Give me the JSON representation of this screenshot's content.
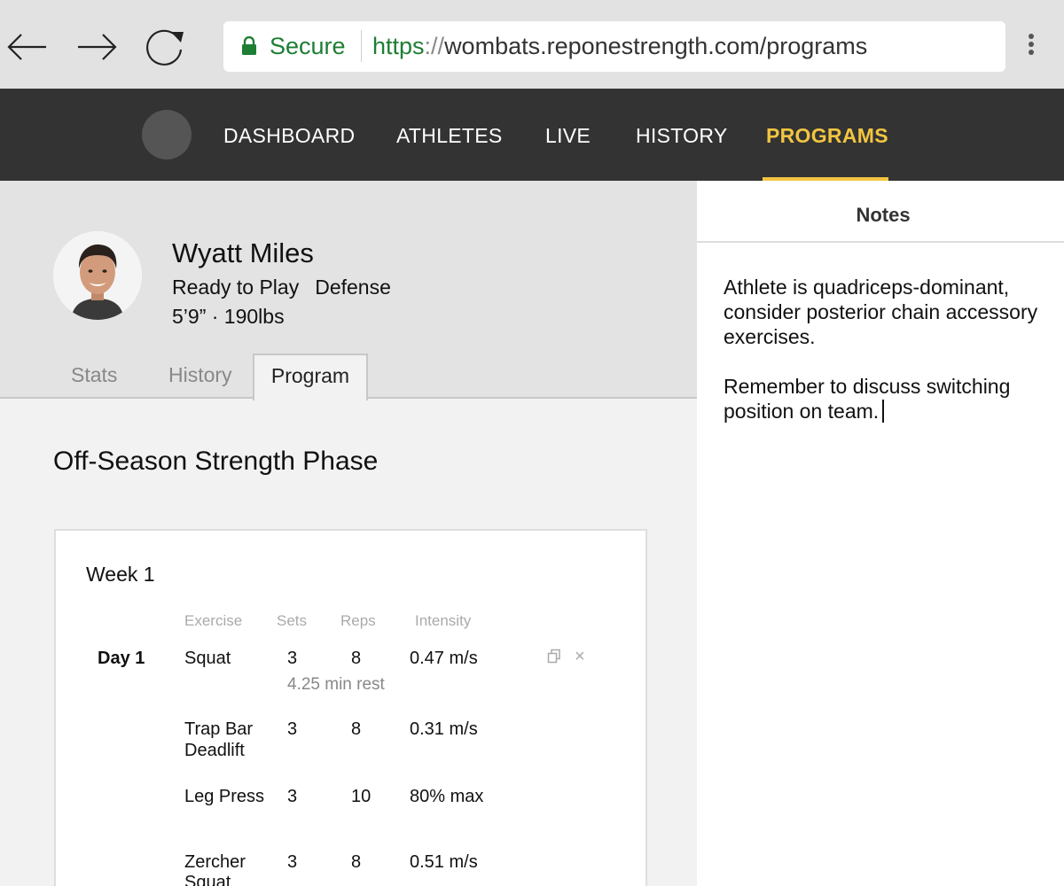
{
  "browser": {
    "secure_label": "Secure",
    "url_scheme": "https",
    "url_slashes": "://",
    "url_rest": "wombats.reponestrength.com/programs",
    "secure_color": "#1e7e34"
  },
  "nav": {
    "items": [
      {
        "label": "DASHBOARD"
      },
      {
        "label": "ATHLETES"
      },
      {
        "label": "LIVE"
      },
      {
        "label": "HISTORY"
      },
      {
        "label": "PROGRAMS",
        "active": true
      }
    ],
    "active_color": "#f2c541",
    "background": "#333333"
  },
  "athlete": {
    "name": "Wyatt Miles",
    "status": "Ready to Play",
    "position": "Defense",
    "size": "5’9” · 190lbs"
  },
  "tabs": [
    {
      "label": "Stats"
    },
    {
      "label": "History"
    },
    {
      "label": "Program",
      "active": true
    }
  ],
  "program": {
    "title": "Off-Season Strength Phase",
    "week": "Week 1",
    "columns": [
      "Exercise",
      "Sets",
      "Reps",
      "Intensity"
    ],
    "day_label": "Day 1",
    "rows": [
      {
        "exercise_line1": "Squat",
        "exercise_line2": "",
        "sets": "3",
        "reps": "8",
        "intensity": "0.47 m/s",
        "rest": "4.25 min rest"
      },
      {
        "exercise_line1": "Trap Bar",
        "exercise_line2": "Deadlift",
        "sets": "3",
        "reps": "8",
        "intensity": "0.31 m/s"
      },
      {
        "exercise_line1": "Leg Press",
        "exercise_line2": "",
        "sets": "3",
        "reps": "10",
        "intensity": "80% max"
      },
      {
        "exercise_line1": "Zercher",
        "exercise_line2": "Squat",
        "sets": "3",
        "reps": "8",
        "intensity": "0.51 m/s"
      }
    ]
  },
  "notes": {
    "title": "Notes",
    "paragraph1": "Athlete is quadriceps-dominant, consider posterior chain accessory exercises.",
    "paragraph2": "Remember to discuss switching position on team."
  },
  "icons": {
    "back": "arrow-left-icon",
    "forward": "arrow-right-icon",
    "reload": "reload-icon",
    "lock": "lock-icon",
    "menu": "vertical-dots-icon",
    "copy": "copy-icon",
    "remove": "close-icon"
  }
}
